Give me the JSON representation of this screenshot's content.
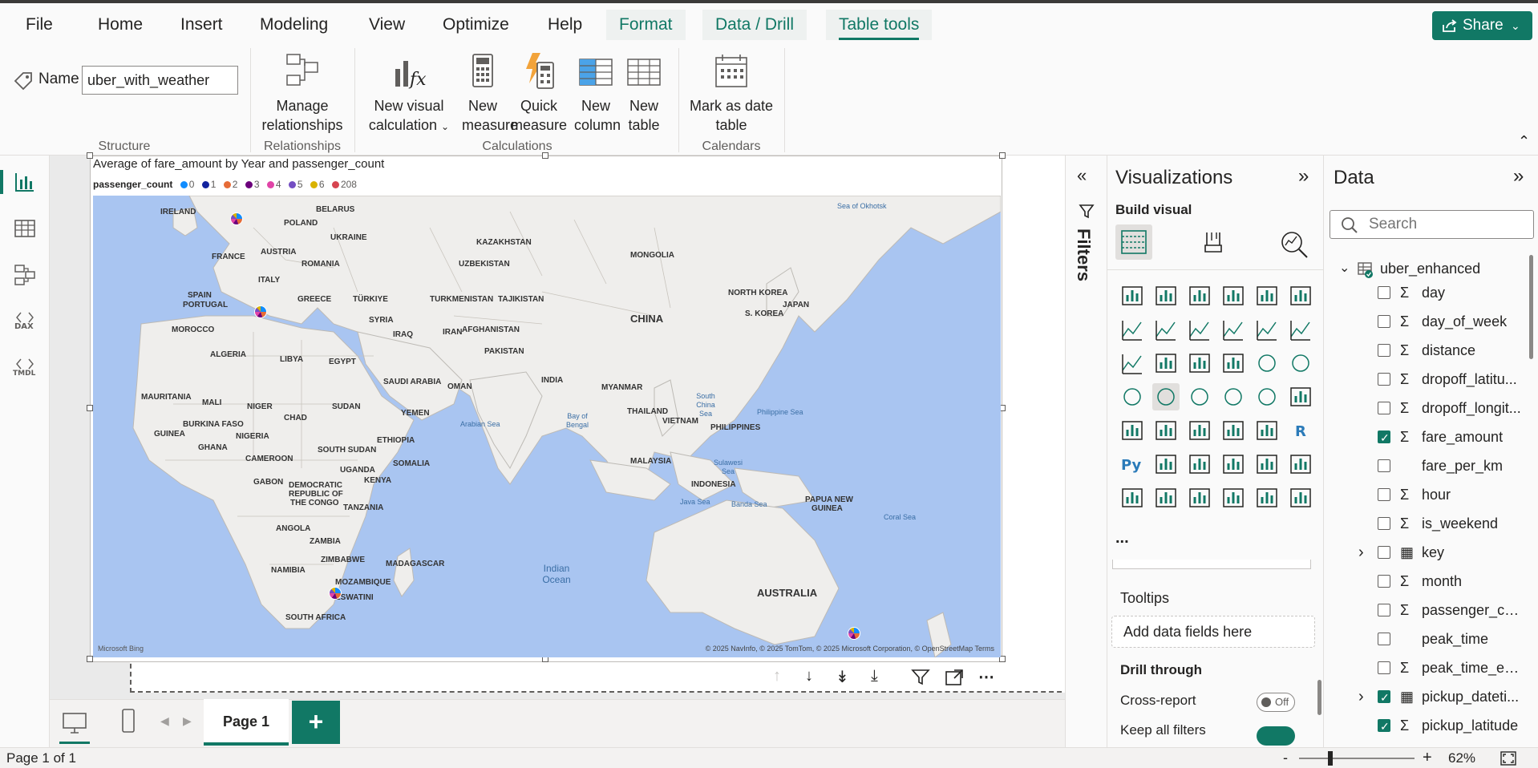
{
  "menu": {
    "items": [
      "File",
      "Home",
      "Insert",
      "Modeling",
      "View",
      "Optimize",
      "Help"
    ],
    "context_items": [
      "Format",
      "Data / Drill",
      "Table tools"
    ],
    "active": "Table tools",
    "share_label": "Share"
  },
  "ribbon": {
    "name_label": "Name",
    "name_value": "uber_with_weather",
    "groups": {
      "structure": "Structure",
      "relationships": "Relationships",
      "calculations": "Calculations",
      "calendars": "Calendars"
    },
    "buttons": {
      "manage_relationships": [
        "Manage",
        "relationships"
      ],
      "new_visual_calculation": [
        "New visual",
        "calculation"
      ],
      "new_measure": [
        "New",
        "measure"
      ],
      "quick_measure": [
        "Quick",
        "measure"
      ],
      "new_column": [
        "New",
        "column"
      ],
      "new_table": [
        "New",
        "table"
      ],
      "mark_as_date_table": [
        "Mark as date",
        "table"
      ]
    }
  },
  "visual": {
    "title": "Average of fare_amount by Year and passenger_count",
    "legend_title": "passenger_count",
    "legend": [
      {
        "label": "0",
        "color": "#118dff"
      },
      {
        "label": "1",
        "color": "#12239e"
      },
      {
        "label": "2",
        "color": "#e66c37"
      },
      {
        "label": "3",
        "color": "#6b007b"
      },
      {
        "label": "4",
        "color": "#e044a7"
      },
      {
        "label": "5",
        "color": "#744ec2"
      },
      {
        "label": "6",
        "color": "#d9b300"
      },
      {
        "label": "208",
        "color": "#d64550"
      }
    ],
    "attribution": "© 2025 NavInfo, © 2025 TomTom, © 2025 Microsoft Corporation, © OpenStreetMap  Terms",
    "bing": "Microsoft Bing",
    "places": [
      "IRELAND",
      "BELARUS",
      "POLAND",
      "UKRAINE",
      "KAZAKHSTAN",
      "MONGOLIA",
      "FRANCE",
      "AUSTRIA",
      "ROMANIA",
      "UZBEKISTAN",
      "ITALY",
      "SPAIN",
      "PORTUGAL",
      "GREECE",
      "TÜRKIYE",
      "TURKMENISTAN",
      "TAJIKISTAN",
      "NORTH KOREA",
      "JAPAN",
      "S. KOREA",
      "CHINA",
      "SYRIA",
      "IRAQ",
      "IRAN",
      "AFGHANISTAN",
      "PAKISTAN",
      "MOROCCO",
      "ALGERIA",
      "LIBYA",
      "EGYPT",
      "SAUDI ARABIA",
      "OMAN",
      "INDIA",
      "MYANMAR",
      "MAURITANIA",
      "MALI",
      "NIGER",
      "SUDAN",
      "CHAD",
      "YEMEN",
      "THAILAND",
      "VIETNAM",
      "PHILIPPINES",
      "BURKINA FASO",
      "GUINEA",
      "NIGERIA",
      "GHANA",
      "SOUTH SUDAN",
      "ETHIOPIA",
      "SOMALIA",
      "CAMEROON",
      "UGANDA",
      "KENYA",
      "MALAYSIA",
      "GABON",
      "DEMOCRATIC",
      "REPUBLIC OF",
      "THE CONGO",
      "TANZANIA",
      "INDONESIA",
      "PAPUA NEW",
      "GUINEA",
      "ANGOLA",
      "ZAMBIA",
      "ZIMBABWE",
      "NAMIBIA",
      "MADAGASCAR",
      "MOZAMBIQUE",
      "ESWATINI",
      "SOUTH AFRICA",
      "AUSTRALIA"
    ],
    "seas": [
      "Sea of Okhotsk",
      "Arabian Sea",
      "Bay of Bengal",
      "South China Sea",
      "Philippine Sea",
      "Sulawesi Sea",
      "Java Sea",
      "Banda Sea",
      "Indian Ocean",
      "Coral Sea"
    ]
  },
  "pages": {
    "tab": "Page 1",
    "add": "+"
  },
  "status": {
    "page_info": "Page 1 of 1",
    "zoom": "62%"
  },
  "filters": {
    "label": "Filters"
  },
  "visualizations": {
    "title": "Visualizations",
    "build_visual": "Build visual",
    "more": "...",
    "tooltips_label": "Tooltips",
    "add_fields": "Add data fields here",
    "drill_through": "Drill through",
    "cross_report": "Cross-report",
    "cross_report_state": "Off",
    "keep_all_filters": "Keep all filters"
  },
  "data": {
    "title": "Data",
    "search_placeholder": "Search",
    "table_name": "uber_enhanced",
    "fields": [
      {
        "name": "day",
        "sigma": true,
        "checked": false
      },
      {
        "name": "day_of_week",
        "sigma": true,
        "checked": false
      },
      {
        "name": "distance",
        "sigma": true,
        "checked": false
      },
      {
        "name": "dropoff_latitu...",
        "sigma": true,
        "checked": false
      },
      {
        "name": "dropoff_longit...",
        "sigma": true,
        "checked": false
      },
      {
        "name": "fare_amount",
        "sigma": true,
        "checked": true
      },
      {
        "name": "fare_per_km",
        "sigma": false,
        "checked": false
      },
      {
        "name": "hour",
        "sigma": true,
        "checked": false
      },
      {
        "name": "is_weekend",
        "sigma": true,
        "checked": false
      },
      {
        "name": "key",
        "sigma": false,
        "checked": false,
        "expand": true,
        "calendar": true
      },
      {
        "name": "month",
        "sigma": true,
        "checked": false
      },
      {
        "name": "passenger_co...",
        "sigma": true,
        "checked": false
      },
      {
        "name": "peak_time",
        "sigma": false,
        "checked": false
      },
      {
        "name": "peak_time_en...",
        "sigma": true,
        "checked": false
      },
      {
        "name": "pickup_dateti...",
        "sigma": false,
        "checked": true,
        "expand": true,
        "calendar": true
      },
      {
        "name": "pickup_latitude",
        "sigma": true,
        "checked": true
      }
    ]
  },
  "colors": {
    "accent": "#117865",
    "map_water": "#a9c5f1",
    "map_land": "#efeeec"
  }
}
